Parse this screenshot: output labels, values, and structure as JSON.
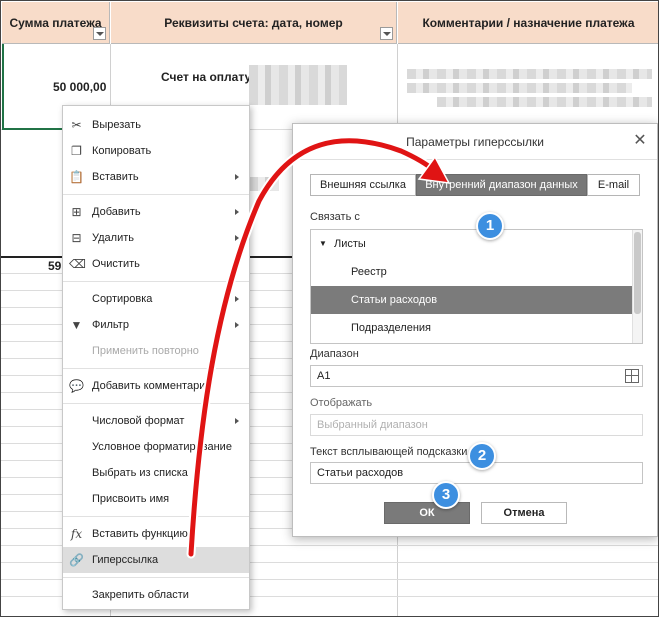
{
  "sheet": {
    "columns": [
      {
        "header": "Сумма платежа"
      },
      {
        "header": "Реквизиты счета: дата, номер"
      },
      {
        "header": "Комментарии / назначение платежа"
      }
    ],
    "row1": {
      "amount": "50 000,00",
      "invoice": "Счет на оплату"
    },
    "total_partial": "59"
  },
  "context_menu": {
    "items": [
      {
        "label": "Вырезать",
        "icon": "scissors-icon"
      },
      {
        "label": "Копировать",
        "icon": "copy-icon"
      },
      {
        "label": "Вставить",
        "icon": "paste-icon",
        "submenu": true
      },
      {
        "label": "Добавить",
        "icon": "insert-cells-icon",
        "submenu": true
      },
      {
        "label": "Удалить",
        "icon": "delete-cells-icon",
        "submenu": true
      },
      {
        "label": "Очистить",
        "icon": "eraser-icon"
      },
      {
        "label": "Сортировка",
        "submenu": true
      },
      {
        "label": "Фильтр",
        "icon": "filter-icon",
        "submenu": true
      },
      {
        "label": "Применить повторно",
        "disabled": true
      },
      {
        "label": "Добавить комментарий",
        "icon": "comment-icon"
      },
      {
        "label": "Числовой формат",
        "submenu": true
      },
      {
        "label": "Условное форматирование"
      },
      {
        "label": "Выбрать из списка"
      },
      {
        "label": "Присвоить имя"
      },
      {
        "label": "Вставить функцию",
        "icon": "function-icon"
      },
      {
        "label": "Гиперссылка",
        "icon": "hyperlink-icon",
        "highlighted": true
      },
      {
        "label": "Закрепить области"
      }
    ]
  },
  "dialog": {
    "title": "Параметры гиперссылки",
    "tabs": [
      "Внешняя ссылка",
      "Внутренний диапазон данных",
      "E-mail"
    ],
    "active_tab": "Внутренний диапазон данных",
    "link_to_label": "Связать с",
    "tree": {
      "group": "Листы",
      "sheets": [
        "Реестр",
        "Статьи расходов",
        "Подразделения"
      ],
      "selected": "Статьи расходов"
    },
    "range_label": "Диапазон",
    "range_value": "A1",
    "display_label": "Отображать",
    "display_placeholder": "Выбранный диапазон",
    "tooltip_label": "Текст всплывающей подсказки",
    "tooltip_value": "Статьи расходов",
    "ok_label": "ОК",
    "cancel_label": "Отмена"
  },
  "badges": [
    "1",
    "2",
    "3"
  ],
  "colors": {
    "header_bg": "#f8dcc9",
    "badge": "#3d8fe0",
    "arrow": "#e01414",
    "active_tab": "#777777"
  }
}
